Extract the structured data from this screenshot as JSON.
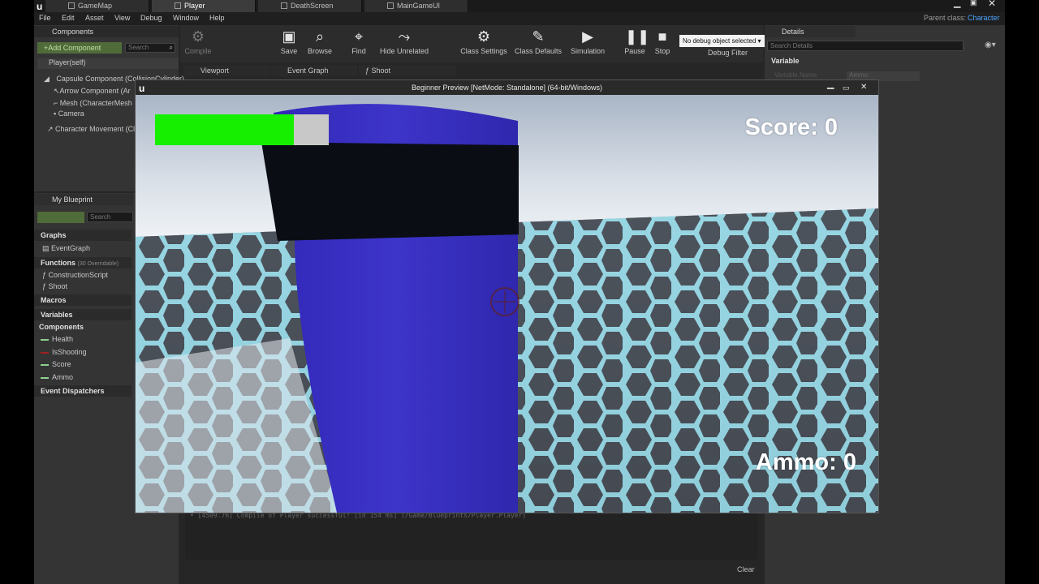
{
  "document_tabs": [
    "GameMap",
    "Player",
    "DeathScreen",
    "MainGameUI"
  ],
  "parent_class": {
    "label": "Parent class:",
    "value": "Character"
  },
  "menu": [
    "File",
    "Edit",
    "Asset",
    "View",
    "Debug",
    "Window",
    "Help"
  ],
  "components_panel": {
    "title": "Components",
    "add_button": "+Add Component",
    "search_placeholder": "Search",
    "root": "Player(self)",
    "items": [
      "Capsule Component (CollisionCylinder)",
      "Arrow Component (Ar",
      "Mesh (CharacterMesh",
      "Camera",
      "Character Movement (Cl"
    ]
  },
  "toolbar": {
    "buttons": [
      "Compile",
      "Save",
      "Browse",
      "Find",
      "Hide Unrelated",
      "Class Settings",
      "Class Defaults",
      "Simulation",
      "Pause",
      "Stop"
    ],
    "debug_select": "No debug object selected",
    "debug_filter": "Debug Filter"
  },
  "graph_tabs": [
    "Viewport",
    "Event Graph",
    "Shoot"
  ],
  "my_blueprint": {
    "title": "My Blueprint",
    "search_placeholder": "Search",
    "graphs_header": "Graphs",
    "graphs": [
      "EventGraph"
    ],
    "functions_header": "Functions",
    "functions_note": "(30 Overridable)",
    "functions": [
      "ConstructionScript",
      "Shoot"
    ],
    "macros_header": "Macros",
    "variables_header": "Variables",
    "components_header": "Components",
    "variables": [
      {
        "name": "Health",
        "color": "#8fd18f"
      },
      {
        "name": "IsShooting",
        "color": "#a02020"
      },
      {
        "name": "Score",
        "color": "#8fd18f"
      },
      {
        "name": "Ammo",
        "color": "#8fd18f"
      }
    ],
    "event_dispatchers": "Event Dispatchers"
  },
  "details_panel": {
    "title": "Details",
    "search_placeholder": "Search Details",
    "section": "Variable",
    "variable_name_label": "Variable Name",
    "variable_name_value": "Ammo"
  },
  "preview_window": {
    "title": "Beginner Preview [NetMode: Standalone]  (64-bit/Windows)",
    "hud": {
      "score": "Score: 0",
      "ammo": "Ammo: 0",
      "health_fraction": 0.8
    }
  },
  "output_log": {
    "line": "[4509.76] Compile of Player successful! [in 154 ms] (/Game/Blueprints/Player.Player)",
    "clear_button": "Clear"
  },
  "colors": {
    "health_fill": "#16f000",
    "health_back": "#c8c8c8",
    "capsule": "#3a2fc0",
    "band": "#0a0d14",
    "parent_class_value": "#4aa3ff"
  }
}
